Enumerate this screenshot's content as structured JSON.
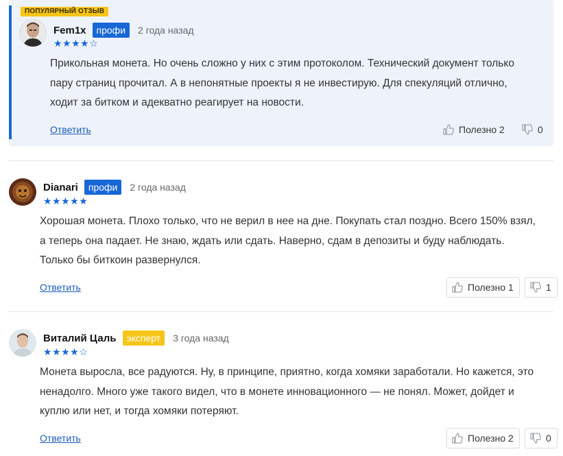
{
  "popular_label": "ПОПУЛЯРНЫЙ ОТЗЫВ",
  "reviews": [
    {
      "author": "Fem1x",
      "badge": "профи",
      "date": "2 года назад",
      "rating": 4,
      "stars": "★★★★☆",
      "lines": [
        "Прикольная монета. Но очень сложно у них с этим протоколом. Технический документ только",
        "пару страниц прочитал. А в непонятные проекты я не инвестирую. Для спекуляций отлично,",
        "ходит за битком и адекватно реагирует на новости."
      ],
      "reply_label": "Ответить",
      "useful_label": "Полезно 2",
      "dislike_count": "0"
    },
    {
      "author": "Dianari",
      "badge": "профи",
      "date": "2 года назад",
      "rating": 5,
      "stars": "★★★★★",
      "lines": [
        "Хорошая монета. Плохо только, что не верил в нее на дне. Покупать стал поздно. Всего 150% взял,",
        "а теперь она падает. Не знаю, ждать или сдать. Наверно, сдам в депозиты и буду наблюдать.",
        "Только бы биткоин развернулся."
      ],
      "reply_label": "Ответить",
      "useful_label": "Полезно 1",
      "dislike_count": "1"
    },
    {
      "author": "Виталий Цаль",
      "badge": "эксперт",
      "date": "3 года назад",
      "rating": 4,
      "stars": "★★★★☆",
      "lines": [
        "Монета выросла, все радуются. Ну, в принципе, приятно, когда хомяки заработали. Но кажется, это",
        "ненадолго. Много уже такого видел, что в монете инновационного — не понял. Может, дойдет и",
        "куплю или нет, и тогда хомяки потеряют."
      ],
      "reply_label": "Ответить",
      "useful_label": "Полезно 2",
      "dislike_count": "0"
    }
  ],
  "colors": {
    "accent": "#1767d6",
    "expert": "#f5c518",
    "popular_bg": "#eef3fb"
  }
}
